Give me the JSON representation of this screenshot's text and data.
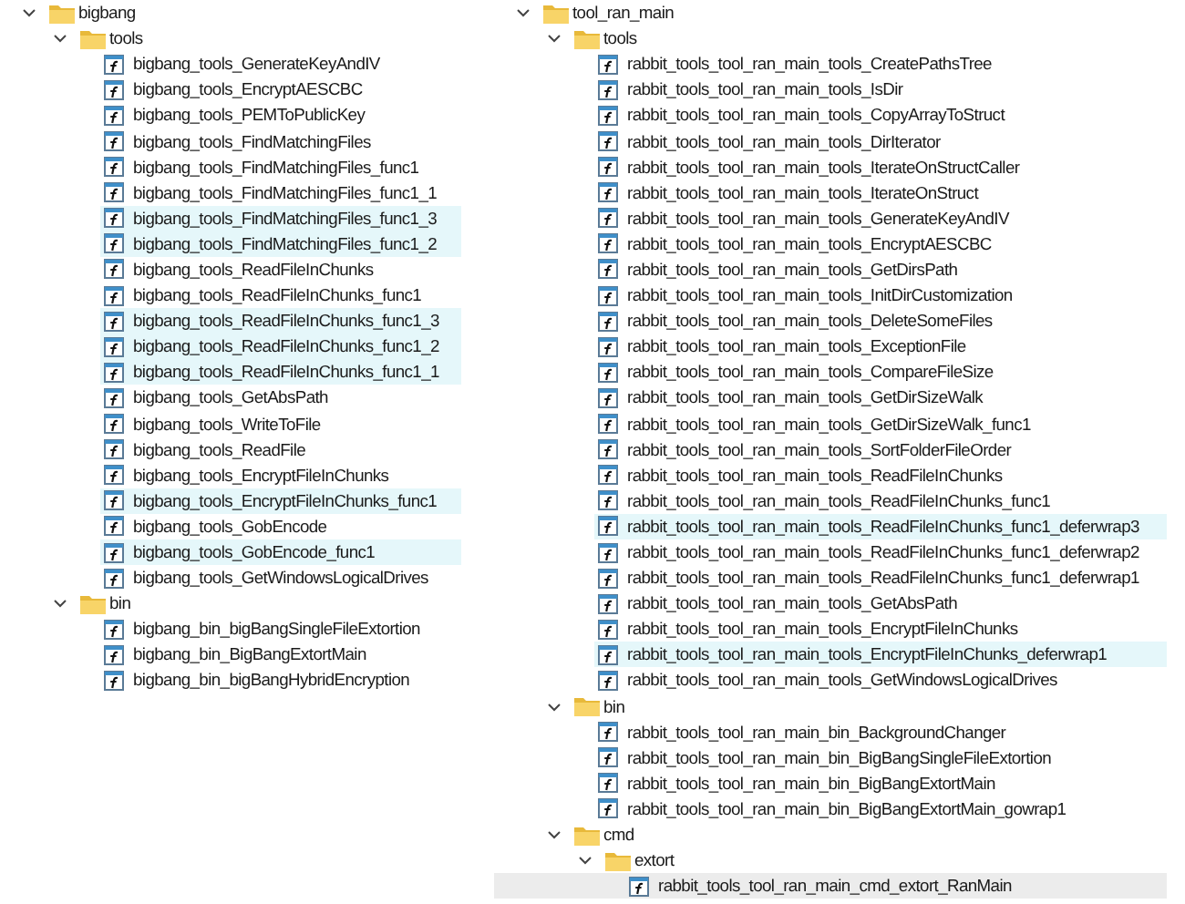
{
  "panels": [
    {
      "root": {
        "label": "bigbang",
        "kind": "folder",
        "expanded": true,
        "children": [
          {
            "label": "tools",
            "kind": "folder",
            "expanded": true,
            "children": [
              {
                "label": "bigbang_tools_GenerateKeyAndIV",
                "kind": "function",
                "highlighted": false,
                "selected": false
              },
              {
                "label": "bigbang_tools_EncryptAESCBC",
                "kind": "function",
                "highlighted": false,
                "selected": false
              },
              {
                "label": "bigbang_tools_PEMToPublicKey",
                "kind": "function",
                "highlighted": false,
                "selected": false
              },
              {
                "label": "bigbang_tools_FindMatchingFiles",
                "kind": "function",
                "highlighted": false,
                "selected": false
              },
              {
                "label": "bigbang_tools_FindMatchingFiles_func1",
                "kind": "function",
                "highlighted": false,
                "selected": false
              },
              {
                "label": "bigbang_tools_FindMatchingFiles_func1_1",
                "kind": "function",
                "highlighted": false,
                "selected": false
              },
              {
                "label": "bigbang_tools_FindMatchingFiles_func1_3",
                "kind": "function",
                "highlighted": true,
                "selected": false
              },
              {
                "label": "bigbang_tools_FindMatchingFiles_func1_2",
                "kind": "function",
                "highlighted": true,
                "selected": false
              },
              {
                "label": "bigbang_tools_ReadFileInChunks",
                "kind": "function",
                "highlighted": false,
                "selected": false
              },
              {
                "label": "bigbang_tools_ReadFileInChunks_func1",
                "kind": "function",
                "highlighted": false,
                "selected": false
              },
              {
                "label": "bigbang_tools_ReadFileInChunks_func1_3",
                "kind": "function",
                "highlighted": true,
                "selected": false
              },
              {
                "label": "bigbang_tools_ReadFileInChunks_func1_2",
                "kind": "function",
                "highlighted": true,
                "selected": false
              },
              {
                "label": "bigbang_tools_ReadFileInChunks_func1_1",
                "kind": "function",
                "highlighted": true,
                "selected": false
              },
              {
                "label": "bigbang_tools_GetAbsPath",
                "kind": "function",
                "highlighted": false,
                "selected": false
              },
              {
                "label": "bigbang_tools_WriteToFile",
                "kind": "function",
                "highlighted": false,
                "selected": false
              },
              {
                "label": "bigbang_tools_ReadFile",
                "kind": "function",
                "highlighted": false,
                "selected": false
              },
              {
                "label": "bigbang_tools_EncryptFileInChunks",
                "kind": "function",
                "highlighted": false,
                "selected": false
              },
              {
                "label": "bigbang_tools_EncryptFileInChunks_func1",
                "kind": "function",
                "highlighted": true,
                "selected": false
              },
              {
                "label": "bigbang_tools_GobEncode",
                "kind": "function",
                "highlighted": false,
                "selected": false
              },
              {
                "label": "bigbang_tools_GobEncode_func1",
                "kind": "function",
                "highlighted": true,
                "selected": false
              },
              {
                "label": "bigbang_tools_GetWindowsLogicalDrives",
                "kind": "function",
                "highlighted": false,
                "selected": false
              }
            ]
          },
          {
            "label": "bin",
            "kind": "folder",
            "expanded": true,
            "children": [
              {
                "label": "bigbang_bin_bigBangSingleFileExtortion",
                "kind": "function",
                "highlighted": false,
                "selected": false
              },
              {
                "label": "bigbang_bin_BigBangExtortMain",
                "kind": "function",
                "highlighted": false,
                "selected": false
              },
              {
                "label": "bigbang_bin_bigBangHybridEncryption",
                "kind": "function",
                "highlighted": false,
                "selected": false
              }
            ]
          }
        ]
      }
    },
    {
      "root": {
        "label": "tool_ran_main",
        "kind": "folder",
        "expanded": true,
        "children": [
          {
            "label": "tools",
            "kind": "folder",
            "expanded": true,
            "children": [
              {
                "label": "rabbit_tools_tool_ran_main_tools_CreatePathsTree",
                "kind": "function",
                "highlighted": false,
                "selected": false
              },
              {
                "label": "rabbit_tools_tool_ran_main_tools_IsDir",
                "kind": "function",
                "highlighted": false,
                "selected": false
              },
              {
                "label": "rabbit_tools_tool_ran_main_tools_CopyArrayToStruct",
                "kind": "function",
                "highlighted": false,
                "selected": false
              },
              {
                "label": "rabbit_tools_tool_ran_main_tools_DirIterator",
                "kind": "function",
                "highlighted": false,
                "selected": false
              },
              {
                "label": "rabbit_tools_tool_ran_main_tools_IterateOnStructCaller",
                "kind": "function",
                "highlighted": false,
                "selected": false
              },
              {
                "label": "rabbit_tools_tool_ran_main_tools_IterateOnStruct",
                "kind": "function",
                "highlighted": false,
                "selected": false
              },
              {
                "label": "rabbit_tools_tool_ran_main_tools_GenerateKeyAndIV",
                "kind": "function",
                "highlighted": false,
                "selected": false
              },
              {
                "label": "rabbit_tools_tool_ran_main_tools_EncryptAESCBC",
                "kind": "function",
                "highlighted": false,
                "selected": false
              },
              {
                "label": "rabbit_tools_tool_ran_main_tools_GetDirsPath",
                "kind": "function",
                "highlighted": false,
                "selected": false
              },
              {
                "label": "rabbit_tools_tool_ran_main_tools_InitDirCustomization",
                "kind": "function",
                "highlighted": false,
                "selected": false
              },
              {
                "label": "rabbit_tools_tool_ran_main_tools_DeleteSomeFiles",
                "kind": "function",
                "highlighted": false,
                "selected": false
              },
              {
                "label": "rabbit_tools_tool_ran_main_tools_ExceptionFile",
                "kind": "function",
                "highlighted": false,
                "selected": false
              },
              {
                "label": "rabbit_tools_tool_ran_main_tools_CompareFileSize",
                "kind": "function",
                "highlighted": false,
                "selected": false
              },
              {
                "label": "rabbit_tools_tool_ran_main_tools_GetDirSizeWalk",
                "kind": "function",
                "highlighted": false,
                "selected": false
              },
              {
                "label": "rabbit_tools_tool_ran_main_tools_GetDirSizeWalk_func1",
                "kind": "function",
                "highlighted": false,
                "selected": false
              },
              {
                "label": "rabbit_tools_tool_ran_main_tools_SortFolderFileOrder",
                "kind": "function",
                "highlighted": false,
                "selected": false
              },
              {
                "label": "rabbit_tools_tool_ran_main_tools_ReadFileInChunks",
                "kind": "function",
                "highlighted": false,
                "selected": false
              },
              {
                "label": "rabbit_tools_tool_ran_main_tools_ReadFileInChunks_func1",
                "kind": "function",
                "highlighted": false,
                "selected": false
              },
              {
                "label": "rabbit_tools_tool_ran_main_tools_ReadFileInChunks_func1_deferwrap3",
                "kind": "function",
                "highlighted": true,
                "selected": false
              },
              {
                "label": "rabbit_tools_tool_ran_main_tools_ReadFileInChunks_func1_deferwrap2",
                "kind": "function",
                "highlighted": false,
                "selected": false
              },
              {
                "label": "rabbit_tools_tool_ran_main_tools_ReadFileInChunks_func1_deferwrap1",
                "kind": "function",
                "highlighted": false,
                "selected": false
              },
              {
                "label": "rabbit_tools_tool_ran_main_tools_GetAbsPath",
                "kind": "function",
                "highlighted": false,
                "selected": false
              },
              {
                "label": "rabbit_tools_tool_ran_main_tools_EncryptFileInChunks",
                "kind": "function",
                "highlighted": false,
                "selected": false
              },
              {
                "label": "rabbit_tools_tool_ran_main_tools_EncryptFileInChunks_deferwrap1",
                "kind": "function",
                "highlighted": true,
                "selected": false
              },
              {
                "label": "rabbit_tools_tool_ran_main_tools_GetWindowsLogicalDrives",
                "kind": "function",
                "highlighted": false,
                "selected": false
              }
            ]
          },
          {
            "label": "bin",
            "kind": "folder",
            "expanded": true,
            "children": [
              {
                "label": "rabbit_tools_tool_ran_main_bin_BackgroundChanger",
                "kind": "function",
                "highlighted": false,
                "selected": false
              },
              {
                "label": "rabbit_tools_tool_ran_main_bin_BigBangSingleFileExtortion",
                "kind": "function",
                "highlighted": false,
                "selected": false
              },
              {
                "label": "rabbit_tools_tool_ran_main_bin_BigBangExtortMain",
                "kind": "function",
                "highlighted": false,
                "selected": false
              },
              {
                "label": "rabbit_tools_tool_ran_main_bin_BigBangExtortMain_gowrap1",
                "kind": "function",
                "highlighted": false,
                "selected": false
              }
            ]
          },
          {
            "label": "cmd",
            "kind": "folder",
            "expanded": true,
            "children": [
              {
                "label": "extort",
                "kind": "folder",
                "expanded": true,
                "children": [
                  {
                    "label": "rabbit_tools_tool_ran_main_cmd_extort_RanMain",
                    "kind": "function",
                    "highlighted": false,
                    "selected": true
                  }
                ]
              }
            ]
          }
        ]
      }
    }
  ]
}
